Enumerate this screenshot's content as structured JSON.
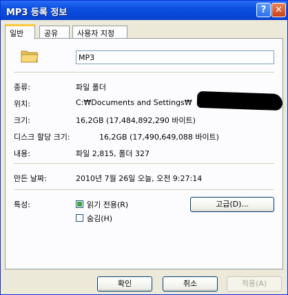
{
  "window": {
    "title": "MP3 등록 정보",
    "help_label": "?",
    "close_label": "✕"
  },
  "tabs": [
    {
      "label": "일반",
      "active": true
    },
    {
      "label": "공유",
      "active": false
    },
    {
      "label": "사용자 지정",
      "active": false
    }
  ],
  "general": {
    "folder_name": "MP3",
    "type_label": "종류:",
    "type_value": "파일 폴더",
    "location_label": "위치:",
    "location_value": "C:₩Documents and Settings₩",
    "size_label": "크기:",
    "size_value": "16,2GB (17,484,892,290 바이트)",
    "disk_size_label": "디스크 할당 크기:",
    "disk_size_value": "16,2GB (17,490,649,088 바이트)",
    "contents_label": "내용:",
    "contents_value": "파일 2,815, 폴더 327",
    "created_label": "만든 날짜:",
    "created_value": "2010년 7월 26일 오늘, 오전 9:27:14",
    "attributes_label": "특성:",
    "readonly_label": "읽기 전용(R)",
    "readonly_checked": true,
    "hidden_label": "숨김(H)",
    "hidden_checked": false,
    "advanced_label": "고급(D)..."
  },
  "footer": {
    "ok_label": "확인",
    "cancel_label": "취소",
    "apply_label": "적용(A)"
  },
  "colors": {
    "titlebar": "#0a50e0",
    "dialog_bg": "#ece9d8",
    "panel_bg": "#fcfcfe",
    "tab_highlight": "#ffc83c"
  },
  "icons": {
    "folder": "folder-icon",
    "help": "help-icon",
    "close": "close-icon"
  }
}
